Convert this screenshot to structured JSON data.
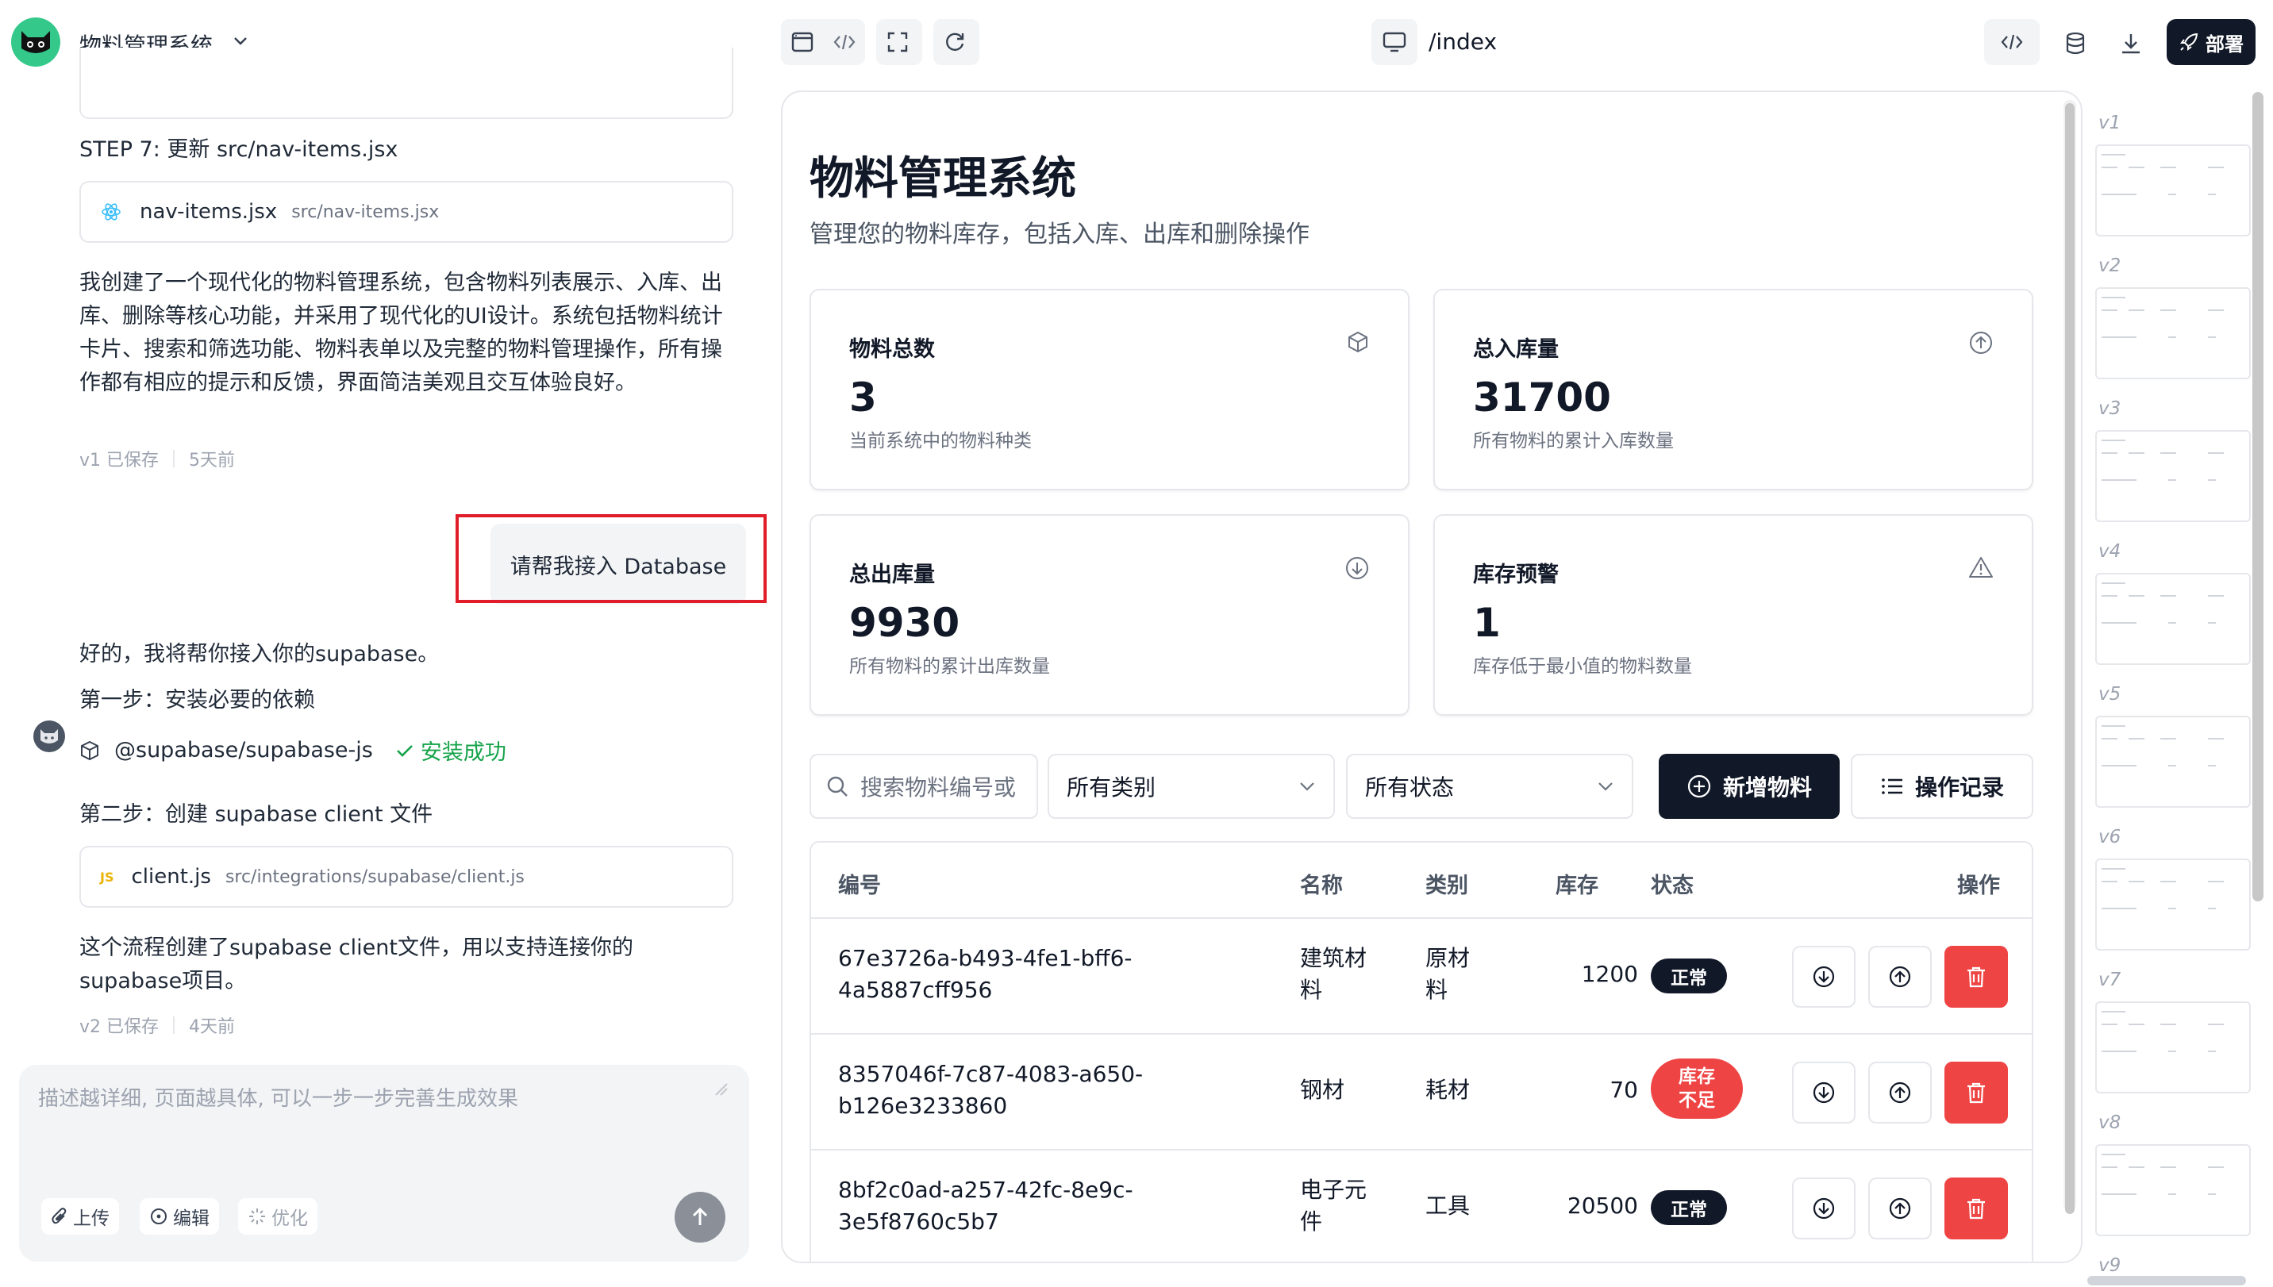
{
  "app": {
    "title": "物料管理系统"
  },
  "route": {
    "path": "/index"
  },
  "toolbar": {
    "deploy_label": "部署"
  },
  "chat": {
    "step7": "STEP 7: 更新 src/nav-items.jsx",
    "file1": {
      "name": "nav-items.jsx",
      "path": "src/nav-items.jsx"
    },
    "summary": "我创建了一个现代化的物料管理系统，包含物料列表展示、入库、出库、删除等核心功能，并采用了现代化的UI设计。系统包括物料统计卡片、搜索和筛选功能、物料表单以及完整的物料管理操作，所有操作都有相应的提示和反馈，界面简洁美观且交互体验良好。",
    "meta1": {
      "version": "v1 已保存",
      "time": "5天前"
    },
    "user_msg": "请帮我接入 Database",
    "bot_intro": "好的，我将帮你接入你的supabase。",
    "step1": "第一步：安装必要的依赖",
    "dependency": {
      "name": "@supabase/supabase-js",
      "status": "安装成功"
    },
    "step2": "第二步：创建 supabase client 文件",
    "file2": {
      "badge": "JS",
      "name": "client.js",
      "path": "src/integrations/supabase/client.js"
    },
    "result": "这个流程创建了supabase client文件，用以支持连接你的supabase项目。",
    "meta2": {
      "version": "v2 已保存",
      "time": "4天前"
    },
    "composer": {
      "placeholder": "描述越详细, 页面越具体, 可以一步一步完善生成效果",
      "upload": "上传",
      "edit": "编辑",
      "optimize": "优化"
    }
  },
  "preview": {
    "title": "物料管理系统",
    "subtitle": "管理您的物料库存，包括入库、出库和删除操作",
    "stats": [
      {
        "title": "物料总数",
        "value": "3",
        "desc": "当前系统中的物料种类",
        "icon": "box-icon"
      },
      {
        "title": "总入库量",
        "value": "31700",
        "desc": "所有物料的累计入库数量",
        "icon": "arrow-up-circle-icon"
      },
      {
        "title": "总出库量",
        "value": "9930",
        "desc": "所有物料的累计出库数量",
        "icon": "arrow-down-circle-icon"
      },
      {
        "title": "库存预警",
        "value": "1",
        "desc": "库存低于最小值的物料数量",
        "icon": "warning-icon"
      }
    ],
    "search_placeholder": "搜索物料编号或",
    "category_select": "所有类别",
    "status_select": "所有状态",
    "add_button": "新增物料",
    "log_button": "操作记录",
    "table": {
      "headers": [
        "编号",
        "名称",
        "类别",
        "库存",
        "状态",
        "操作"
      ],
      "rows": [
        {
          "id_l1": "67e3726a-b493-4fe1-bff6-",
          "id_l2": "4a5887cff956",
          "name_l1": "建筑材",
          "name_l2": "料",
          "cat_l1": "原材",
          "cat_l2": "料",
          "stock": "1200",
          "status": "正常",
          "status_l2": ""
        },
        {
          "id_l1": "8357046f-7c87-4083-a650-",
          "id_l2": "b126e3233860",
          "name_l1": "钢材",
          "name_l2": "",
          "cat_l1": "耗材",
          "cat_l2": "",
          "stock": "70",
          "status": "库存",
          "status_l2": "不足"
        },
        {
          "id_l1": "8bf2c0ad-a257-42fc-8e9c-",
          "id_l2": "3e5f8760c5b7",
          "name_l1": "电子元",
          "name_l2": "件",
          "cat_l1": "工具",
          "cat_l2": "",
          "stock": "20500",
          "status": "正常",
          "status_l2": ""
        }
      ]
    }
  },
  "versions": [
    "v1",
    "v2",
    "v3",
    "v4",
    "v5",
    "v6",
    "v7",
    "v8",
    "v9"
  ],
  "colors": {
    "accent": "#111827",
    "danger": "#ef4444",
    "success": "#16a34a",
    "logo": "#34c98a"
  }
}
